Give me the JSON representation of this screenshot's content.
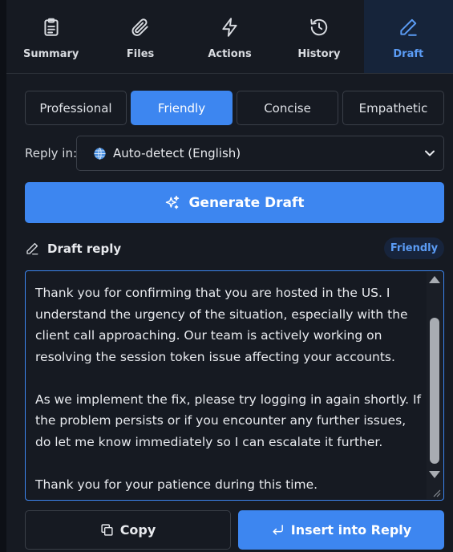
{
  "tabs": [
    {
      "label": "Summary",
      "icon": "clipboard-icon",
      "active": false
    },
    {
      "label": "Files",
      "icon": "paperclip-icon",
      "active": false
    },
    {
      "label": "Actions",
      "icon": "lightning-icon",
      "active": false
    },
    {
      "label": "History",
      "icon": "history-icon",
      "active": false
    },
    {
      "label": "Draft",
      "icon": "pen-icon",
      "active": true
    }
  ],
  "tones": [
    {
      "label": "Professional",
      "active": false
    },
    {
      "label": "Friendly",
      "active": true
    },
    {
      "label": "Concise",
      "active": false
    },
    {
      "label": "Empathetic",
      "active": false
    }
  ],
  "reply_in": {
    "label": "Reply in:",
    "value": "Auto-detect (English)",
    "icon": "globe-icon"
  },
  "generate": {
    "label": "Generate Draft",
    "icon": "sparkles-icon"
  },
  "draft": {
    "title": "Draft reply",
    "badge": "Friendly",
    "paragraphs": [
      "Thank you for confirming that you are hosted in the US. I understand the urgency of the situation, especially with the client call approaching. Our team is actively working on resolving the session token issue affecting your accounts.",
      "As we implement the fix, please try logging in again shortly. If the problem persists or if you encounter any further issues, do let me know immediately so I can escalate it further.",
      "Thank you for your patience during this time."
    ]
  },
  "actions": {
    "copy_label": "Copy",
    "insert_label": "Insert into Reply"
  },
  "colors": {
    "accent": "#3d86f0",
    "background": "#161a22",
    "active_tab": "#16243a",
    "badge_bg": "#17243c"
  }
}
